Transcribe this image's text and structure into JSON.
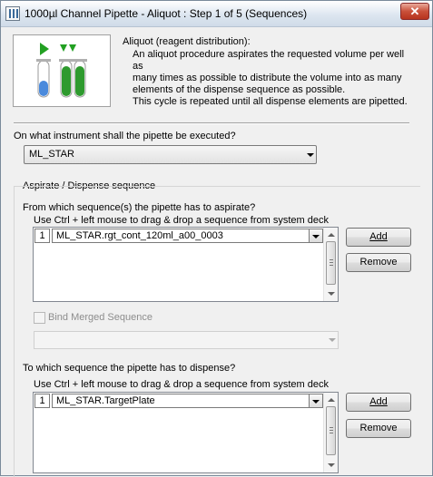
{
  "window": {
    "title": "1000µl Channel Pipette - Aliquot : Step 1 of 5 (Sequences)",
    "close_glyph": "✕"
  },
  "header": {
    "icon": "aliquot-tubes-icon",
    "heading": "Aliquot (reagent distribution):",
    "description": [
      "An aliquot procedure aspirates the requested volume per well as",
      "many times as possible to distribute the volume into as many",
      "elements of the dispense sequence as possible.",
      "This cycle is repeated until all dispense elements are pipetted."
    ],
    "colors": {
      "arrow_green": "#22a022",
      "liquid_green": "#2e9a2e",
      "liquid_blue": "#4a8adc"
    }
  },
  "instrument": {
    "question": "On what instrument shall the pipette be executed?",
    "selected": "ML_STAR"
  },
  "group": {
    "title": "Aspirate / Dispense sequence"
  },
  "aspirate": {
    "question": "From which sequence(s) the pipette has to aspirate?",
    "hint": "Use Ctrl + left mouse to drag & drop a sequence from system deck",
    "rows": [
      {
        "num": "1",
        "value": "ML_STAR.rgt_cont_120ml_a00_0003"
      }
    ],
    "add_label": "Add",
    "remove_label": "Remove"
  },
  "merged": {
    "checkbox_label": "Bind Merged Sequence",
    "checked": false,
    "enabled": false
  },
  "dispense": {
    "question": "To which sequence the pipette has to dispense?",
    "hint": "Use Ctrl + left mouse to drag & drop a sequence from system deck",
    "rows": [
      {
        "num": "1",
        "value": "ML_STAR.TargetPlate"
      }
    ],
    "add_label": "Add",
    "remove_label": "Remove"
  }
}
